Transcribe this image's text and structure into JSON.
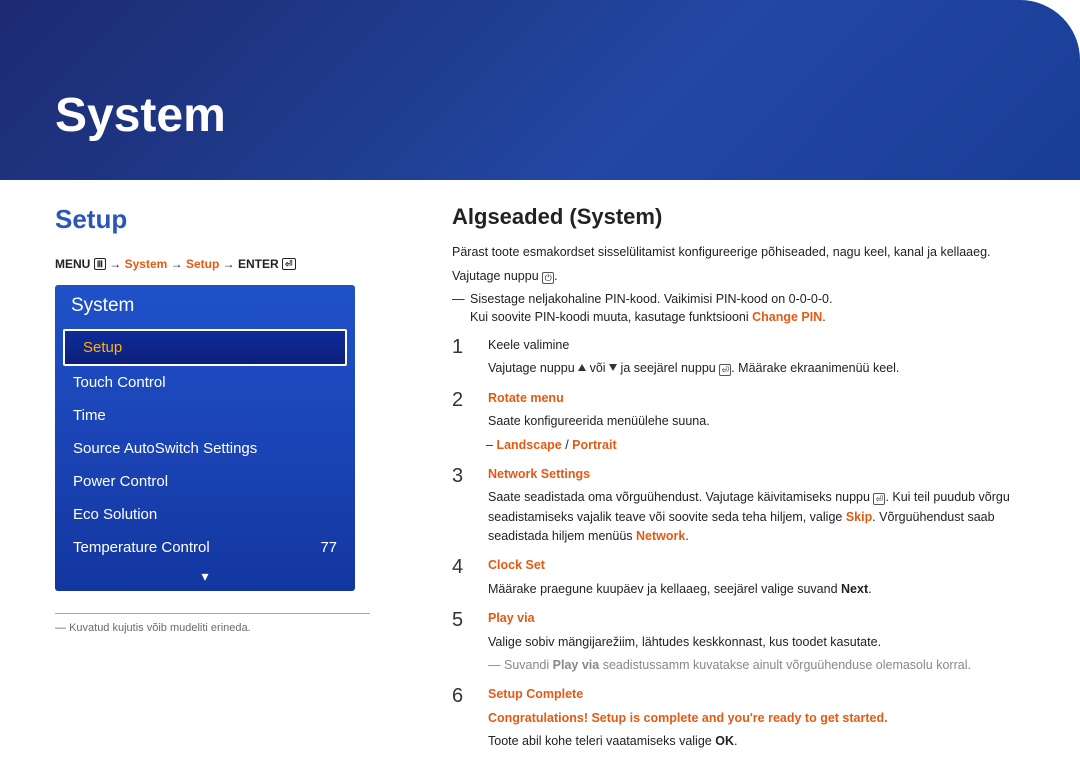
{
  "header": {
    "title": "System"
  },
  "left": {
    "section_title": "Setup",
    "breadcrumb": {
      "menu_label": "MENU",
      "arrow": "→",
      "seg1": "System",
      "seg2": "Setup",
      "enter_label": "ENTER"
    },
    "panel": {
      "title": "System",
      "items": [
        {
          "label": "Setup",
          "value": "",
          "selected": true
        },
        {
          "label": "Touch Control",
          "value": ""
        },
        {
          "label": "Time",
          "value": ""
        },
        {
          "label": "Source AutoSwitch Settings",
          "value": ""
        },
        {
          "label": "Power Control",
          "value": ""
        },
        {
          "label": "Eco Solution",
          "value": ""
        },
        {
          "label": "Temperature Control",
          "value": "77"
        }
      ],
      "more_arrow": "▾"
    },
    "footnote": "Kuvatud kujutis võib mudeliti erineda."
  },
  "right": {
    "title": "Algseaded (System)",
    "intro1": "Pärast toote esmakordset sisselülitamist konfigureerige põhiseaded, nagu keel, kanal ja kellaaeg.",
    "intro2_a": "Vajutage nuppu ",
    "intro2_b": ".",
    "pin1": "Sisestage neljakohaline PIN-kood. Vaikimisi PIN-kood on 0-0-0-0.",
    "pin2_a": "Kui soovite PIN-koodi muuta, kasutage funktsiooni ",
    "pin2_b": "Change PIN",
    "pin2_c": ".",
    "steps": {
      "s1": {
        "num": "1",
        "line1": "Keele valimine",
        "line2_a": "Vajutage nuppu ",
        "line2_b": " või ",
        "line2_c": " ja seejärel nuppu ",
        "line2_d": ". Määrake ekraanimenüü keel."
      },
      "s2": {
        "num": "2",
        "title": "Rotate menu",
        "line": "Saate konfigureerida menüülehe suuna.",
        "opt_a": "Landscape",
        "opt_sep": " / ",
        "opt_b": "Portrait"
      },
      "s3": {
        "num": "3",
        "title": "Network Settings",
        "line_a": "Saate seadistada oma võrguühendust. Vajutage käivitamiseks nuppu ",
        "line_b": ". Kui teil puudub võrgu seadistamiseks vajalik teave või soovite seda teha hiljem, valige ",
        "skip": "Skip",
        "line_c": ". Võrguühendust saab seadistada hiljem menüüs ",
        "network": "Network",
        "line_d": "."
      },
      "s4": {
        "num": "4",
        "title": "Clock Set",
        "line_a": "Määrake praegune kuupäev ja kellaaeg, seejärel valige suvand ",
        "next": "Next",
        "line_b": "."
      },
      "s5": {
        "num": "5",
        "title": "Play via",
        "line": "Valige sobiv mängijarežiim, lähtudes keskkonnast, kus toodet kasutate.",
        "note_a": "Suvandi ",
        "note_b": "Play via",
        "note_c": " seadistussamm kuvatakse ainult võrguühenduse olemasolu korral."
      },
      "s6": {
        "num": "6",
        "title": "Setup Complete",
        "congrats": "Congratulations! Setup is complete and you're ready to get started.",
        "line_a": "Toote abil kohe teleri vaatamiseks valige ",
        "ok": "OK",
        "line_b": "."
      }
    }
  }
}
